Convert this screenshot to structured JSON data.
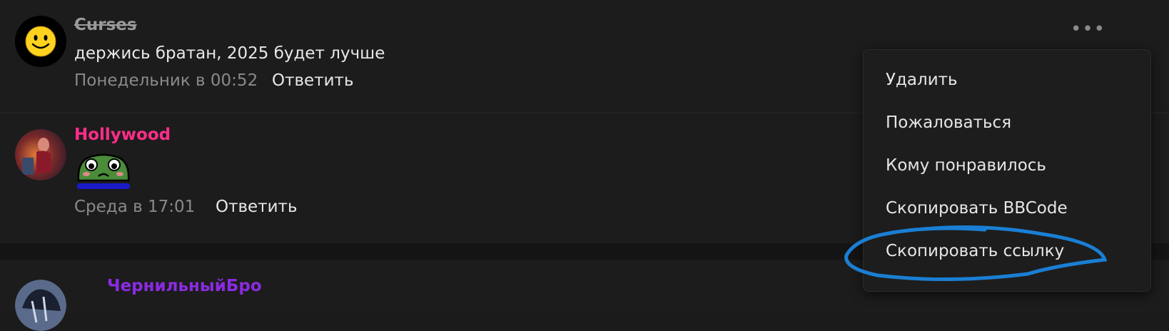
{
  "comments": [
    {
      "author": "Curses",
      "author_color": "#9a9a9a",
      "author_style": "strikethrough",
      "text": "держись братан, 2025 будет лучше",
      "time": "Понедельник в 00:52",
      "reply_label": "Ответить"
    },
    {
      "author": "Hollywood",
      "author_color": "#ff2d8a",
      "sticker": "sad-frog-sticker",
      "time": "Среда в 17:01",
      "reply_label": "Ответить"
    },
    {
      "author": "ЧернильныйБро",
      "author_color": "#8a2be2"
    }
  ],
  "more_icon": "•••",
  "context_menu": {
    "items": [
      {
        "label": "Удалить"
      },
      {
        "label": "Пожаловаться"
      },
      {
        "label": "Кому понравилось"
      },
      {
        "label": "Скопировать BBCode"
      },
      {
        "label": "Скопировать ссылку",
        "highlighted_color": "#1a7fd4"
      }
    ]
  }
}
